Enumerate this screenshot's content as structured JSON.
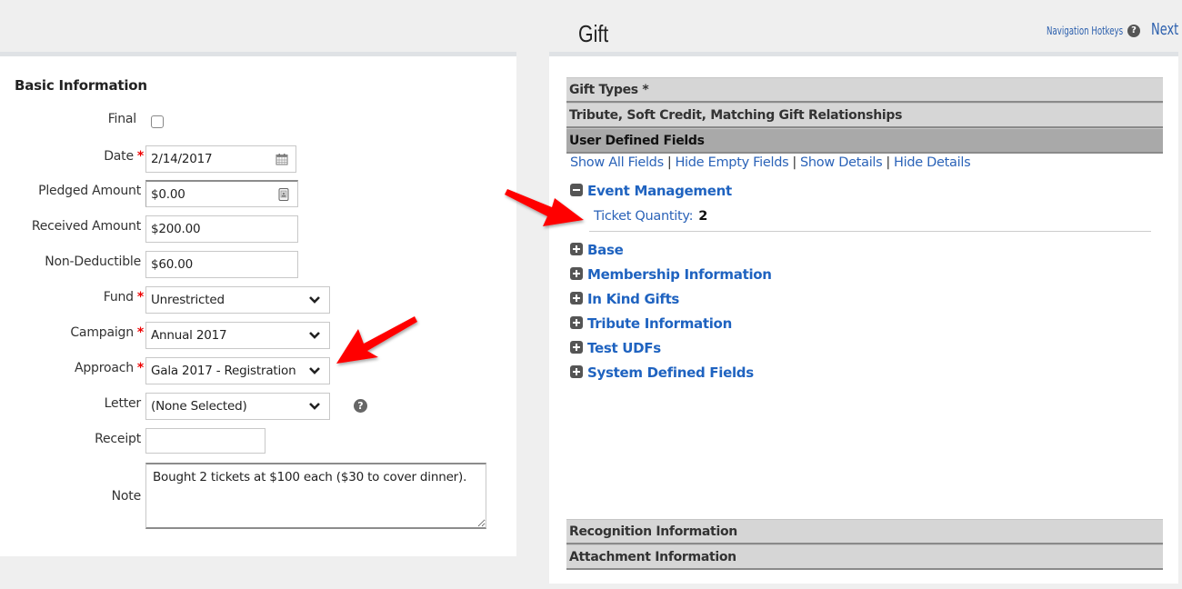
{
  "header": {
    "title": "Gift",
    "nav_hotkeys_label": "Navigation Hotkeys",
    "help_glyph": "?",
    "next_label": "Next :"
  },
  "basic_info": {
    "title": "Basic Information",
    "required_mark": "*",
    "fields": {
      "final": {
        "label": "Final",
        "checked": false
      },
      "date": {
        "label": "Date",
        "value": "2/14/2017",
        "icon": "calendar-icon"
      },
      "pledged_amount": {
        "label": "Pledged Amount",
        "value": "$0.00",
        "icon": "calculator-icon"
      },
      "received_amount": {
        "label": "Received Amount",
        "value": "$200.00"
      },
      "non_deductible": {
        "label": "Non-Deductible",
        "value": "$60.00"
      },
      "fund": {
        "label": "Fund",
        "value": "Unrestricted"
      },
      "campaign": {
        "label": "Campaign",
        "value": "Annual 2017"
      },
      "approach": {
        "label": "Approach",
        "value": "Gala 2017 - Registration"
      },
      "letter": {
        "label": "Letter",
        "value": "(None Selected)",
        "help_glyph": "?"
      },
      "receipt": {
        "label": "Receipt",
        "value": ""
      },
      "note": {
        "label": "Note",
        "value": "Bought 2 tickets at $100 each ($30 to cover dinner)."
      }
    }
  },
  "gift_panel": {
    "sections_top": [
      {
        "label": "Gift Types *"
      },
      {
        "label": "Tribute, Soft Credit, Matching Gift Relationships"
      },
      {
        "label": "User Defined Fields",
        "active": true
      }
    ],
    "udf_links": [
      "Show All Fields",
      "Hide Empty Fields",
      "Show Details",
      "Hide Details"
    ],
    "udf_links_separator": "|",
    "groups": [
      {
        "label": "Event Management",
        "expanded": true,
        "fields": [
          {
            "label": "Ticket Quantity:",
            "value": "2"
          }
        ]
      },
      {
        "label": "Base",
        "expanded": false
      },
      {
        "label": "Membership Information",
        "expanded": false
      },
      {
        "label": "In Kind Gifts",
        "expanded": false
      },
      {
        "label": "Tribute Information",
        "expanded": false
      },
      {
        "label": "Test UDFs",
        "expanded": false
      },
      {
        "label": "System Defined Fields",
        "expanded": false
      }
    ],
    "sections_bottom": [
      {
        "label": "Recognition Information"
      },
      {
        "label": "Attachment Information"
      }
    ]
  },
  "annotations": {
    "arrow_color": "#ff0000"
  }
}
